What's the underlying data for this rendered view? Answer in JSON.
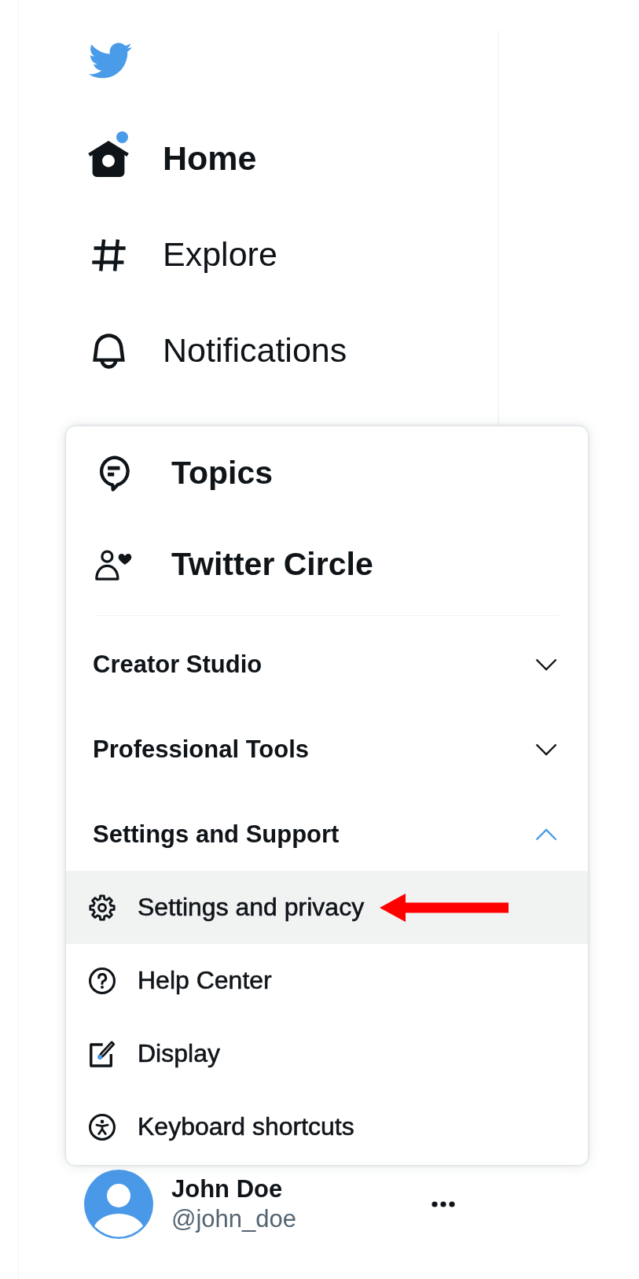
{
  "sidebar": {
    "nav_items": [
      {
        "label": "Home",
        "selected": true,
        "unread": true
      },
      {
        "label": "Explore",
        "selected": false,
        "unread": false
      },
      {
        "label": "Notifications",
        "selected": false,
        "unread": false
      }
    ]
  },
  "more_menu": {
    "primary_items": [
      {
        "label": "Topics"
      },
      {
        "label": "Twitter Circle"
      }
    ],
    "sections": [
      {
        "label": "Creator Studio",
        "expanded": false
      },
      {
        "label": "Professional Tools",
        "expanded": false
      },
      {
        "label": "Settings and Support",
        "expanded": true,
        "items": [
          {
            "label": "Settings and privacy",
            "selected": true,
            "arrow": true
          },
          {
            "label": "Help Center",
            "selected": false,
            "arrow": false
          },
          {
            "label": "Display",
            "selected": false,
            "arrow": false
          },
          {
            "label": "Keyboard shortcuts",
            "selected": false,
            "arrow": false
          }
        ]
      }
    ]
  },
  "account": {
    "name": "John Doe",
    "handle": "@john_doe"
  }
}
